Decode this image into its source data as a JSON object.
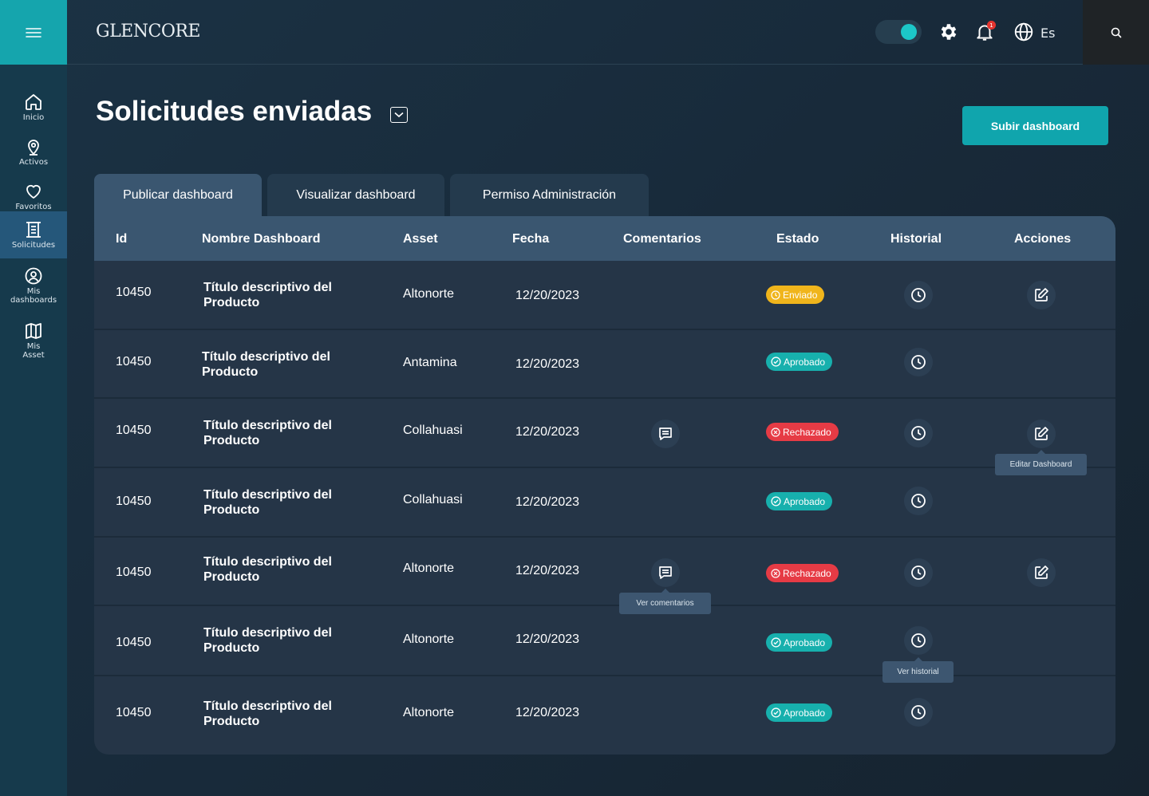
{
  "app": {
    "logo": "GLENCORE",
    "language": "Es",
    "notification_count": "1"
  },
  "colors": {
    "accent": "#10a5ad",
    "enviado": "#f0b51c",
    "aprobado": "#17b0ad",
    "rechazado": "#e63b45"
  },
  "sidebar": {
    "items": [
      {
        "label": "Inicio",
        "icon": "home-icon"
      },
      {
        "label": "Activos",
        "icon": "location-pin-icon"
      },
      {
        "label": "Favoritos",
        "icon": "heart-icon"
      },
      {
        "label": "Solicitudes",
        "icon": "document-list-icon",
        "active": true
      },
      {
        "label": "Mis dashboards",
        "icon": "user-circle-icon"
      },
      {
        "label": "Mis Asset",
        "icon": "map-icon"
      }
    ]
  },
  "page": {
    "title": "Solicitudes enviadas",
    "upload_button": "Subir dashboard"
  },
  "tabs": [
    {
      "label": "Publicar dashboard",
      "active": true
    },
    {
      "label": "Visualizar dashboard",
      "active": false
    },
    {
      "label": "Permiso Administración",
      "active": false
    }
  ],
  "table": {
    "headers": [
      "Id",
      "Nombre Dashboard",
      "Asset",
      "Fecha",
      "Comentarios",
      "Estado",
      "Historial",
      "Acciones"
    ],
    "rows": [
      {
        "id": "10450",
        "name": "Título descriptivo del Producto",
        "asset": "Altonorte",
        "date": "12/20/2023",
        "comment": false,
        "status": "Enviado",
        "status_type": "enviado",
        "edit": true
      },
      {
        "id": "10450",
        "name": "Título descriptivo del Producto",
        "asset": "Antamina",
        "date": "12/20/2023",
        "comment": false,
        "status": "Aprobado",
        "status_type": "aprobado",
        "edit": false
      },
      {
        "id": "10450",
        "name": "Título descriptivo del Producto",
        "asset": "Collahuasi",
        "date": "12/20/2023",
        "comment": true,
        "status": "Rechazado",
        "status_type": "rechazado",
        "edit": true
      },
      {
        "id": "10450",
        "name": "Título descriptivo del Producto",
        "asset": "Collahuasi",
        "date": "12/20/2023",
        "comment": false,
        "status": "Aprobado",
        "status_type": "aprobado",
        "edit": false
      },
      {
        "id": "10450",
        "name": "Título descriptivo del Producto",
        "asset": "Altonorte",
        "date": "12/20/2023",
        "comment": true,
        "status": "Rechazado",
        "status_type": "rechazado",
        "edit": true
      },
      {
        "id": "10450",
        "name": "Título descriptivo del Producto",
        "asset": "Altonorte",
        "date": "12/20/2023",
        "comment": false,
        "status": "Aprobado",
        "status_type": "aprobado",
        "edit": false
      },
      {
        "id": "10450",
        "name": "Título descriptivo del Producto",
        "asset": "Altonorte",
        "date": "12/20/2023",
        "comment": false,
        "status": "Aprobado",
        "status_type": "aprobado",
        "edit": false
      }
    ]
  },
  "tooltips": {
    "edit": "Editar Dashboard",
    "comments": "Ver comentarios",
    "history": "Ver historial"
  }
}
